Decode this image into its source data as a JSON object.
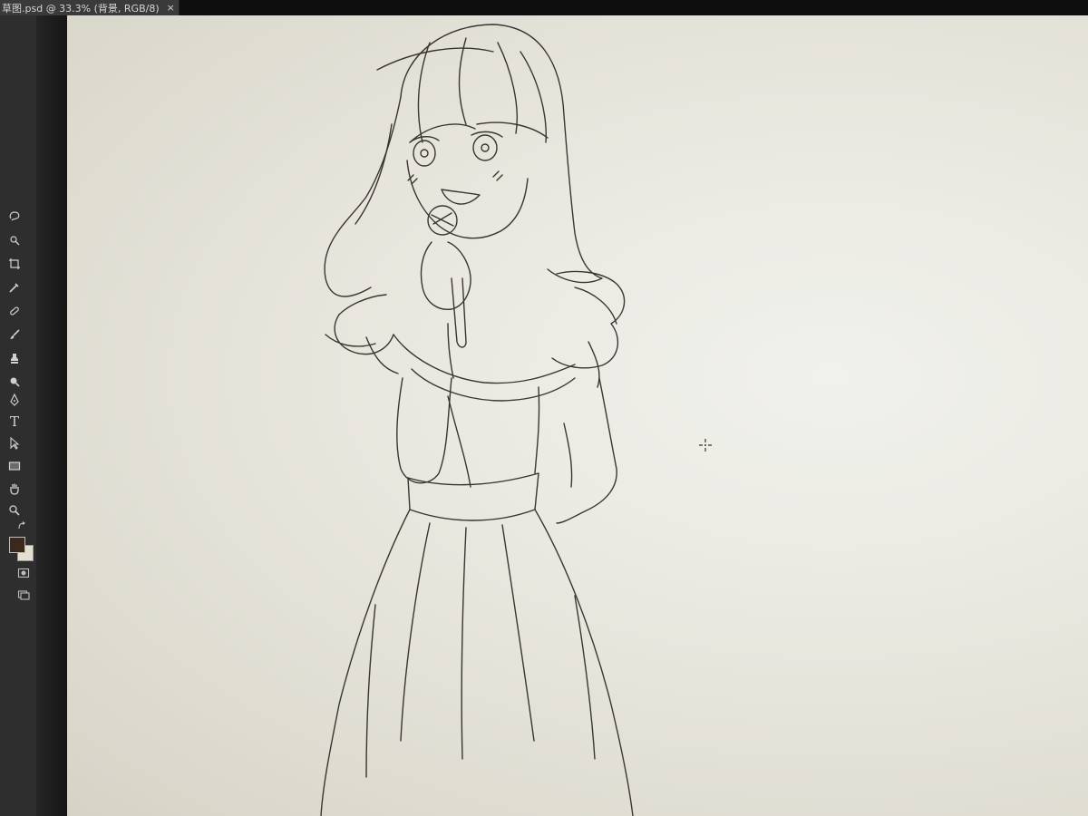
{
  "document_tab": {
    "title": "草图.psd @ 33.3% (背景, RGB/8)",
    "close_glyph": "×"
  },
  "tools": {
    "items": [
      {
        "name": "lasso-tool-icon"
      },
      {
        "name": "quick-select-tool-icon"
      },
      {
        "name": "crop-tool-icon"
      },
      {
        "name": "eyedropper-tool-icon"
      },
      {
        "name": "healing-brush-tool-icon"
      },
      {
        "name": "brush-tool-icon"
      },
      {
        "name": "clone-stamp-tool-icon"
      },
      {
        "name": "eraser-tool-icon"
      },
      {
        "name": "blur-tool-icon"
      },
      {
        "name": "dodge-tool-icon"
      },
      {
        "name": "pen-tool-icon"
      },
      {
        "name": "type-tool-icon"
      },
      {
        "name": "path-selection-tool-icon"
      },
      {
        "name": "rectangle-tool-icon"
      },
      {
        "name": "hand-tool-icon"
      },
      {
        "name": "zoom-tool-icon"
      }
    ],
    "type_tool_glyph": "T"
  },
  "colors": {
    "foreground": "#3b2a1c",
    "background": "#e6dfd0",
    "canvas": "#ecebe4",
    "line_art": "#3a3530"
  },
  "canvas": {
    "subject": "pencil-sketch-girl-singing-with-microphone"
  }
}
